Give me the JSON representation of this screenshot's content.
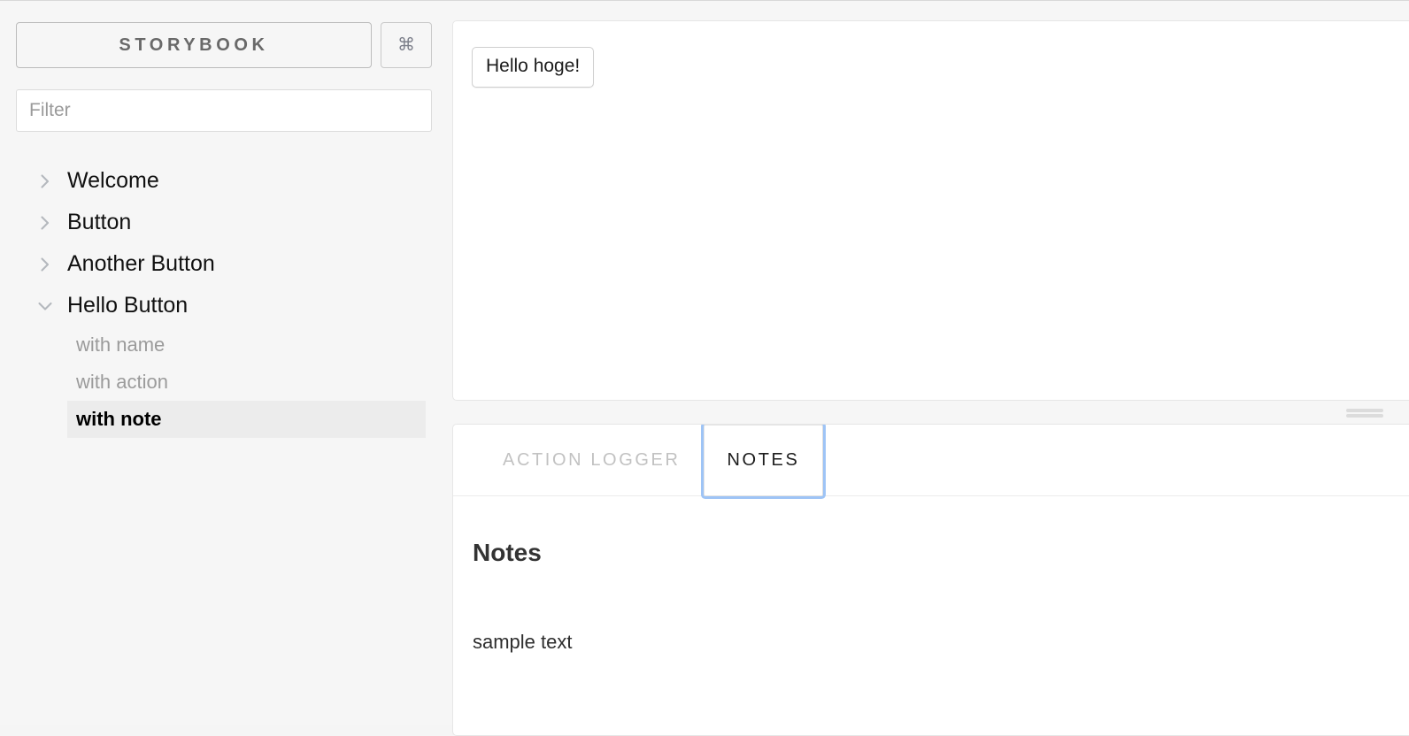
{
  "sidebar": {
    "brand": {
      "title": "STORYBOOK",
      "shortcut_icon": "command-icon",
      "shortcut_glyph": "⌘"
    },
    "filter": {
      "placeholder": "Filter",
      "value": ""
    },
    "tree": [
      {
        "label": "Welcome",
        "expanded": false,
        "icon": "chevron-right-icon",
        "children": []
      },
      {
        "label": "Button",
        "expanded": false,
        "icon": "chevron-right-icon",
        "children": []
      },
      {
        "label": "Another Button",
        "expanded": false,
        "icon": "chevron-right-icon",
        "children": []
      },
      {
        "label": "Hello Button",
        "expanded": true,
        "icon": "chevron-down-icon",
        "children": [
          {
            "label": "with name",
            "selected": false
          },
          {
            "label": "with action",
            "selected": false
          },
          {
            "label": "with note",
            "selected": true
          }
        ]
      }
    ]
  },
  "preview": {
    "story_button_label": "Hello hoge!"
  },
  "resizer": {
    "grip_icon": "drag-handle-icon"
  },
  "addon_panel": {
    "tabs": [
      {
        "label": "ACTION LOGGER",
        "active": false
      },
      {
        "label": "NOTES",
        "active": true
      }
    ],
    "notes": {
      "heading": "Notes",
      "body": "sample text"
    }
  },
  "colors": {
    "sidebar_bg": "#f6f6f6",
    "panel_bg": "#ffffff",
    "selected_row_bg": "#ececec",
    "focus_ring": "#9ec4f6",
    "muted_text": "#9b9b9b",
    "tab_inactive_text": "#c2c2c2",
    "border": "#e6e6e6"
  }
}
